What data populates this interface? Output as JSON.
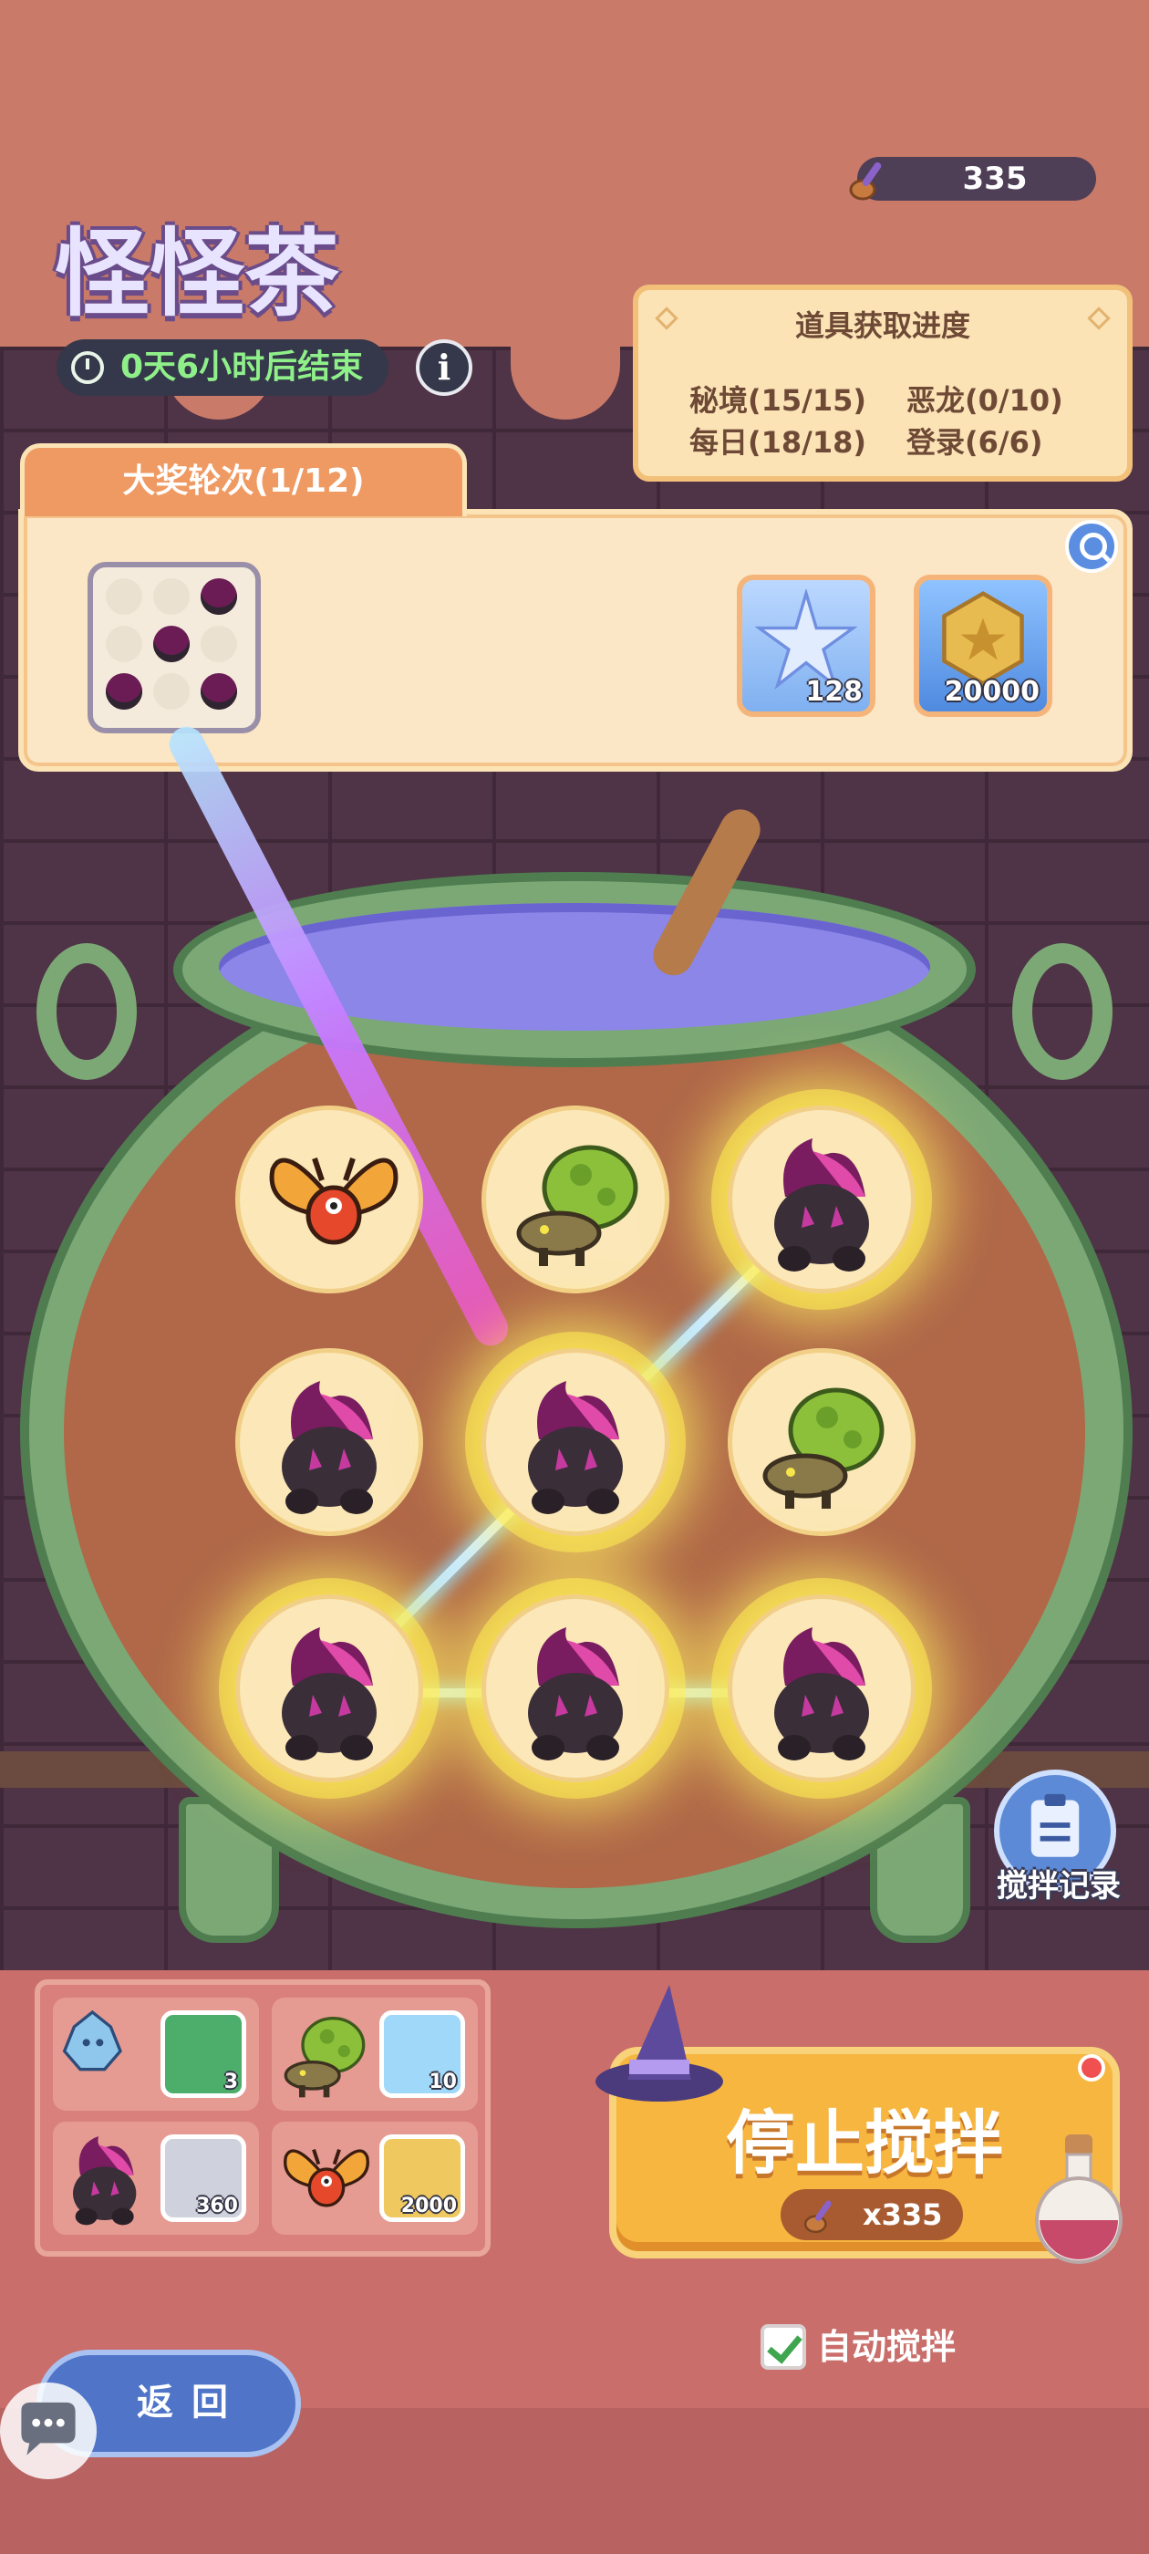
{
  "header": {
    "title": "怪怪茶",
    "timer_text": "0天6小时后结束",
    "info_label": "i",
    "currency_value": "335"
  },
  "progress": {
    "title": "道具获取进度",
    "items": [
      "秘境(15/15)",
      "恶龙(0/10)",
      "每日(18/18)",
      "登录(6/6)"
    ]
  },
  "jackpot": {
    "tab_label": "大奖轮次(1/12)",
    "pattern_cells": [
      false,
      false,
      true,
      false,
      true,
      false,
      true,
      false,
      true
    ],
    "rewards": [
      {
        "icon": "star-crystal-icon",
        "count": "128"
      },
      {
        "icon": "gold-coin-icon",
        "count": "20000"
      }
    ]
  },
  "cauldron": {
    "cells": [
      {
        "monster": "butterfly-monster-icon",
        "glow": false
      },
      {
        "monster": "green-bug-monster-icon",
        "glow": false
      },
      {
        "monster": "dark-flame-monster-icon",
        "glow": true
      },
      {
        "monster": "dark-flame-monster-icon",
        "glow": false
      },
      {
        "monster": "dark-flame-monster-icon",
        "glow": true
      },
      {
        "monster": "green-bug-monster-icon",
        "glow": false
      },
      {
        "monster": "dark-flame-monster-icon",
        "glow": true
      },
      {
        "monster": "dark-flame-monster-icon",
        "glow": true
      },
      {
        "monster": "dark-flame-monster-icon",
        "glow": true
      }
    ]
  },
  "stir_log": {
    "label": "搅拌记录"
  },
  "exchange": [
    {
      "monster": "ice-golem-monster-icon",
      "item": "green-token-icon",
      "count": "3"
    },
    {
      "monster": "green-bug-monster-icon",
      "item": "blue-crystal-icon",
      "count": "10"
    },
    {
      "monster": "dark-flame-monster-icon",
      "item": "silver-ingot-icon",
      "count": "360"
    },
    {
      "monster": "butterfly-monster-icon",
      "item": "gold-coin-icon",
      "count": "2000"
    }
  ],
  "stop_button": {
    "label": "停止搅拌",
    "cost": "x335"
  },
  "auto_stir": {
    "label": "自动搅拌",
    "checked": true
  },
  "back_button": {
    "label": "返回"
  },
  "colors": {
    "accent": "#f7b63f",
    "pot": "#7ca876",
    "liquid": "#8b86e8",
    "timer_text": "#8ff08a"
  }
}
